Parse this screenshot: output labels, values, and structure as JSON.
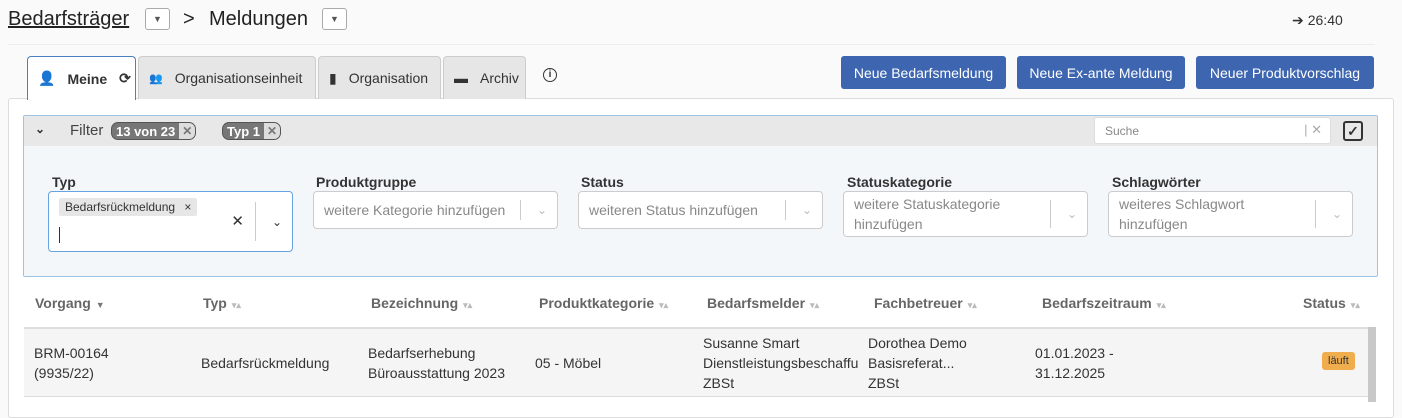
{
  "header": {
    "breadcrumb_root": "Bedarfsträger",
    "separator": ">",
    "breadcrumb_current": "Meldungen",
    "session_timer": "26:40"
  },
  "tabs": [
    {
      "label": "Meine"
    },
    {
      "label": "Organisationseinheit"
    },
    {
      "label": "Organisation"
    },
    {
      "label": "Archiv"
    }
  ],
  "actions": {
    "new_demand": "Neue Bedarfsmeldung",
    "new_exante": "Neue Ex-ante Meldung",
    "new_product": "Neuer Produktvorschlag"
  },
  "filter": {
    "label": "Filter",
    "count_badge": "13 von 23",
    "type_badge": "Typ 1",
    "search_placeholder": "Suche",
    "fields": {
      "typ": {
        "label": "Typ",
        "chip": "Bedarfsrückmeldung"
      },
      "produktgruppe": {
        "label": "Produktgruppe",
        "placeholder": "weitere Kategorie hinzufügen"
      },
      "status": {
        "label": "Status",
        "placeholder": "weiteren Status hinzufügen"
      },
      "statuskategorie": {
        "label": "Statuskategorie",
        "placeholder": "weitere Statuskategorie hinzufügen"
      },
      "schlagwoerter": {
        "label": "Schlagwörter",
        "placeholder": "weiteres Schlagwort hinzufügen"
      }
    }
  },
  "table": {
    "columns": [
      "Vorgang",
      "Typ",
      "Bezeichnung",
      "Produktkategorie",
      "Bedarfsmelder",
      "Fachbetreuer",
      "Bedarfszeitraum",
      "Status"
    ],
    "rows": [
      {
        "vorgang": [
          "BRM-00164",
          "(9935/22)"
        ],
        "typ": "Bedarfsrückmeldung",
        "bezeichnung": [
          "Bedarfserhebung",
          "Büroausstattung 2023"
        ],
        "produktkategorie": "05 - Möbel",
        "melder": [
          "Susanne Smart",
          "Dienstleistungsbeschaffu",
          "ZBSt"
        ],
        "fachbetreuer": [
          "Dorothea Demo",
          "Basisreferat...",
          "ZBSt"
        ],
        "zeitraum": [
          "01.01.2023 -",
          "31.12.2025"
        ],
        "status": "läuft"
      }
    ]
  },
  "colors": {
    "primary": "#3d65b0",
    "status_running": "#f0ad4e"
  }
}
